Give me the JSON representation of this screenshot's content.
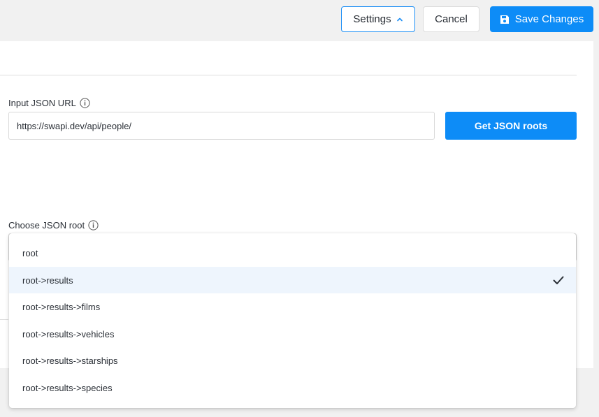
{
  "toolbar": {
    "settings_label": "Settings",
    "cancel_label": "Cancel",
    "save_label": "Save Changes",
    "accent_color": "#0d8cf7"
  },
  "form": {
    "url_label": "Input JSON URL",
    "url_value": "https://swapi.dev/api/people/",
    "get_roots_label": "Get JSON roots",
    "root_label": "Choose JSON root"
  },
  "dropdown": {
    "options": [
      "root",
      "root->results",
      "root->results->films",
      "root->results->vehicles",
      "root->results->starships",
      "root->results->species"
    ],
    "selected": "root->results"
  },
  "icons": {
    "settings_chevron": "chevron-up-icon",
    "save": "floppy-disk-icon",
    "info": "info-icon",
    "selected": "checkmark-icon"
  }
}
